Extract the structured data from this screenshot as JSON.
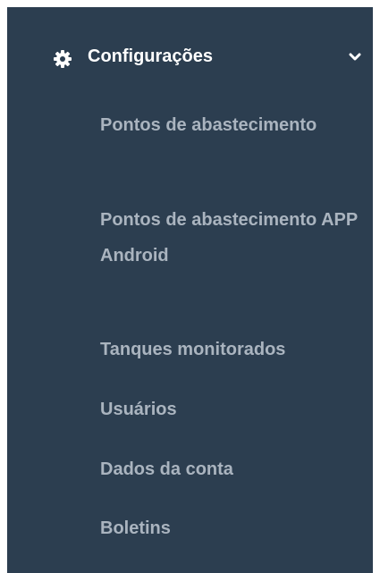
{
  "menu": {
    "header_label": "Configurações",
    "header_icon": "gear-icon",
    "toggle_icon": "chevron-down-icon",
    "items": [
      {
        "label": "Pontos de abastecimento"
      },
      {
        "label": "Pontos de abastecimento APP Android"
      },
      {
        "label": "Tanques monitorados"
      },
      {
        "label": "Usuários"
      },
      {
        "label": "Dados da conta"
      },
      {
        "label": "Boletins"
      }
    ]
  },
  "colors": {
    "sidebar_bg": "#2c3e50",
    "header_text": "#ffffff",
    "item_text": "#aab4bf"
  }
}
